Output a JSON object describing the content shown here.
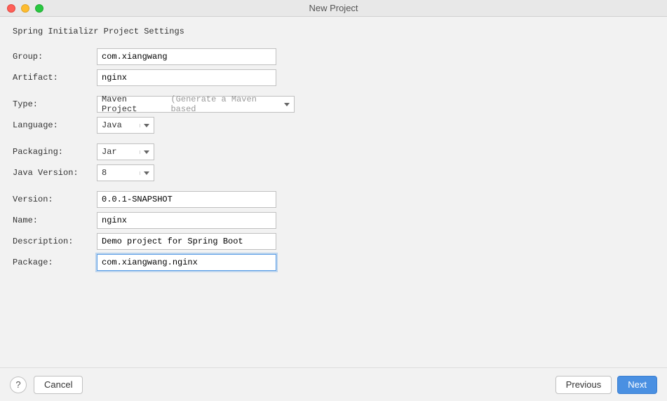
{
  "window": {
    "title": "New Project"
  },
  "section": {
    "header": "Spring Initializr Project Settings"
  },
  "labels": {
    "group": "Group:",
    "artifact": "Artifact:",
    "type": "Type:",
    "language": "Language:",
    "packaging": "Packaging:",
    "javaVersion": "Java Version:",
    "version": "Version:",
    "name": "Name:",
    "description": "Description:",
    "package": "Package:"
  },
  "values": {
    "group": "com.xiangwang",
    "artifact": "nginx",
    "typeMain": "Maven Project",
    "typeHint": "(Generate a Maven based",
    "language": "Java",
    "packaging": "Jar",
    "javaVersion": "8",
    "version": "0.0.1-SNAPSHOT",
    "name": "nginx",
    "description": "Demo project for Spring Boot",
    "package": "com.xiangwang.nginx"
  },
  "footer": {
    "help": "?",
    "cancel": "Cancel",
    "previous": "Previous",
    "next": "Next"
  }
}
